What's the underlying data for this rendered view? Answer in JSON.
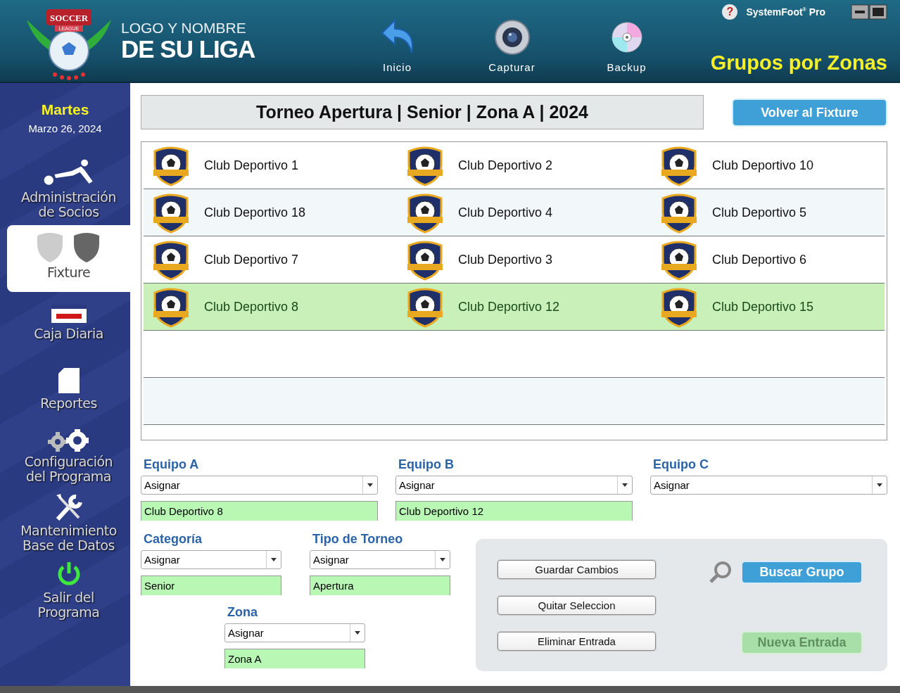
{
  "header": {
    "logo": {
      "top": "SOCCER",
      "ribbon": "LEAGUE"
    },
    "league_name": {
      "line1": "LOGO Y NOMBRE",
      "line2": "DE SU LIGA"
    },
    "nav": [
      {
        "label": "Inicio",
        "kind": "back"
      },
      {
        "label": "Capturar",
        "kind": "camera"
      },
      {
        "label": "Backup",
        "kind": "disc"
      }
    ],
    "help": "?",
    "brand": "SystemFoot$^{®}$ Pro",
    "page_title": "Grupos por Zonas"
  },
  "sidebar": {
    "day": "Martes",
    "date": "Marzo 26, 2024",
    "items": [
      {
        "label": "Administración de Socios",
        "kind": "player",
        "selected": false
      },
      {
        "label": "Fixture",
        "kind": "shields",
        "selected": true
      },
      {
        "label": "Caja Diaria",
        "kind": "cashbox",
        "selected": false
      },
      {
        "label": "Reportes",
        "kind": "document",
        "selected": false
      },
      {
        "label": "Configuración del Programa",
        "kind": "gears",
        "selected": false
      },
      {
        "label": "Mantenimiento Base de Datos",
        "kind": "tools",
        "selected": false
      },
      {
        "label": "Salir del Programa",
        "kind": "power",
        "selected": false
      }
    ]
  },
  "tournament_title": "Torneo Apertura | Senior | Zona A | 2024",
  "back_button": "Volver al Fixture",
  "groups": [
    {
      "selected": false,
      "teams": [
        "Club Deportivo 1",
        "Club Deportivo 2",
        "Club Deportivo 10"
      ]
    },
    {
      "selected": false,
      "teams": [
        "Club Deportivo 18",
        "Club Deportivo 4",
        "Club Deportivo 5"
      ]
    },
    {
      "selected": false,
      "teams": [
        "Club Deportivo 7",
        "Club Deportivo 3",
        "Club Deportivo 6"
      ]
    },
    {
      "selected": true,
      "teams": [
        "Club Deportivo 8",
        "Club Deportivo 12",
        "Club Deportivo 15"
      ]
    },
    {
      "selected": false
    },
    {
      "selected": false
    }
  ],
  "teams_form": [
    {
      "label": "Equipo A",
      "dropdown": "Asignar",
      "value": "Club Deportivo 8"
    },
    {
      "label": "Equipo B",
      "dropdown": "Asignar",
      "value": "Club Deportivo 12"
    },
    {
      "label": "Equipo C",
      "dropdown": "Asignar"
    }
  ],
  "category": {
    "label": "Categoría",
    "dropdown": "Asignar",
    "value": "Senior"
  },
  "tournament_type": {
    "label": "Tipo de Torneo",
    "dropdown": "Asignar",
    "value": "Apertura"
  },
  "zone": {
    "label": "Zona",
    "dropdown": "Asignar",
    "value": "Zona A"
  },
  "actions": [
    {
      "label": "Guardar Cambios",
      "disabled": false
    },
    {
      "label": "Quitar Seleccion",
      "disabled": false
    },
    {
      "label": "Eliminar Entrada",
      "disabled": false
    }
  ],
  "search_button": {
    "label": "Buscar Grupo",
    "disabled": false
  },
  "new_button": {
    "label": "Nueva Entrada",
    "disabled": true
  }
}
